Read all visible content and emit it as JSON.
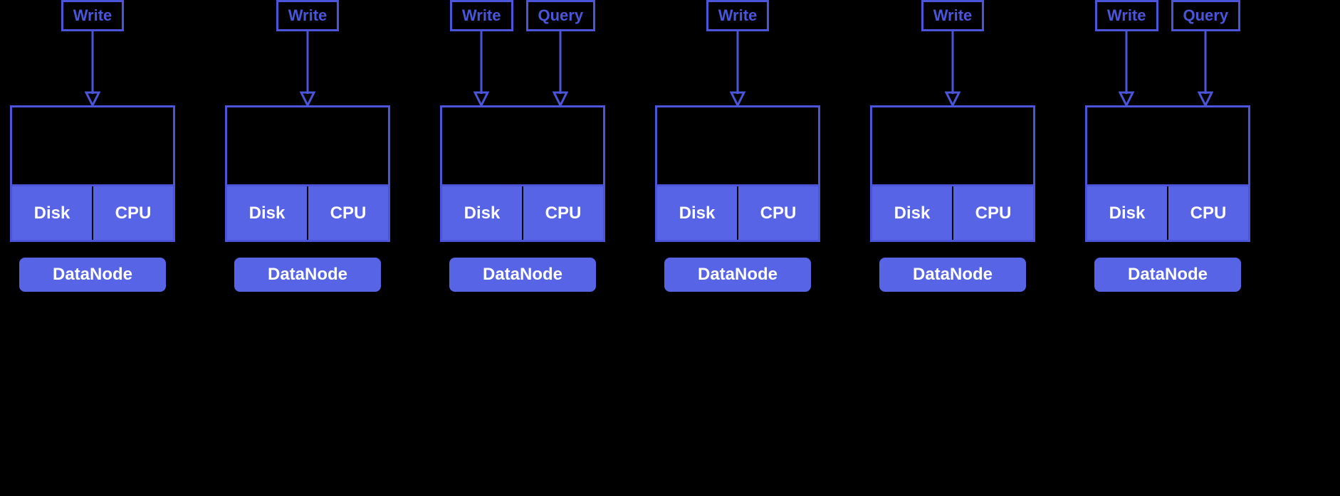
{
  "labels": {
    "write": "Write",
    "query": "Query",
    "disk": "Disk",
    "cpu": "CPU",
    "datanode": "DataNode"
  },
  "colors": {
    "stroke": "#4a55d9",
    "fill": "#5764e6"
  },
  "nodes": [
    {
      "inputs": [
        "write"
      ]
    },
    {
      "inputs": [
        "write"
      ]
    },
    {
      "inputs": [
        "write",
        "query"
      ]
    },
    {
      "inputs": [
        "write"
      ]
    },
    {
      "inputs": [
        "write"
      ]
    },
    {
      "inputs": [
        "write",
        "query"
      ]
    }
  ]
}
